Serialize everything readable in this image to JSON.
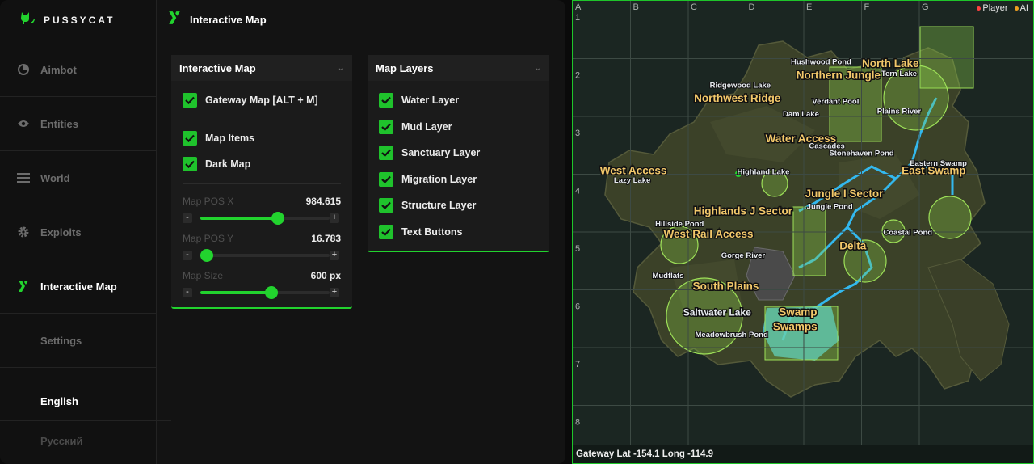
{
  "brand": {
    "name": "PUSSYCAT"
  },
  "topbar": {
    "title": "Interactive Map"
  },
  "sidebar": {
    "items": [
      {
        "label": "Aimbot",
        "icon": "aimbot-icon"
      },
      {
        "label": "Entities",
        "icon": "eye-icon"
      },
      {
        "label": "World",
        "icon": "menu-icon"
      },
      {
        "label": "Exploits",
        "icon": "gear-icon"
      },
      {
        "label": "Interactive Map",
        "icon": "map-logo-icon",
        "active": true
      },
      {
        "label": "Settings"
      }
    ],
    "languages": [
      {
        "label": "English",
        "active": true
      },
      {
        "label": "Русский"
      }
    ]
  },
  "map_panel": {
    "title": "Interactive Map",
    "gateway_label": "Gateway Map [ALT + M]",
    "map_items_label": "Map Items",
    "dark_map_label": "Dark Map",
    "pos_x": {
      "label": "Map POS X",
      "value": "984.615",
      "fraction": 0.6
    },
    "pos_y": {
      "label": "Map POS Y",
      "value": "16.783",
      "fraction": 0.05
    },
    "size": {
      "label": "Map Size",
      "value": "600 px",
      "fraction": 0.55
    }
  },
  "layers_panel": {
    "title": "Map Layers",
    "items": [
      "Water Layer",
      "Mud Layer",
      "Sanctuary Layer",
      "Migration Layer",
      "Structure Layer",
      "Text Buttons"
    ]
  },
  "map": {
    "columns": [
      "A",
      "B",
      "C",
      "D",
      "E",
      "F",
      "G"
    ],
    "rows": [
      "1",
      "2",
      "3",
      "4",
      "5",
      "6",
      "7",
      "8"
    ],
    "legend": {
      "player": "Player",
      "ai": "AI"
    },
    "status": "Gateway  Lat -154.1  Long -114.9",
    "regions": [
      {
        "text": "North Lake",
        "col": 6.5,
        "row": 2.15,
        "kind": "region"
      },
      {
        "text": "Northern Jungle",
        "col": 5.6,
        "row": 2.35,
        "kind": "region"
      },
      {
        "text": "Northwest Ridge",
        "col": 3.85,
        "row": 2.75,
        "kind": "region"
      },
      {
        "text": "Water Access",
        "col": 4.95,
        "row": 3.45,
        "kind": "region"
      },
      {
        "text": "West Access",
        "col": 2.05,
        "row": 4.0,
        "kind": "region"
      },
      {
        "text": "East Swamp",
        "col": 7.25,
        "row": 4.0,
        "kind": "region"
      },
      {
        "text": "Jungle I Sector",
        "col": 5.7,
        "row": 4.4,
        "kind": "region"
      },
      {
        "text": "Highlands J Sector",
        "col": 3.95,
        "row": 4.7,
        "kind": "region"
      },
      {
        "text": "West Rail Access",
        "col": 3.35,
        "row": 5.1,
        "kind": "region"
      },
      {
        "text": "Delta",
        "col": 5.85,
        "row": 5.3,
        "kind": "region"
      },
      {
        "text": "South Plains",
        "col": 3.65,
        "row": 6.0,
        "kind": "region"
      },
      {
        "text": "Swamp",
        "col": 4.9,
        "row": 6.45,
        "kind": "region"
      },
      {
        "text": "Swamps",
        "col": 4.85,
        "row": 6.7,
        "kind": "region"
      },
      {
        "text": "Hushwood Pond",
        "col": 5.3,
        "row": 2.1,
        "kind": "place"
      },
      {
        "text": "Tern Lake",
        "col": 6.65,
        "row": 2.3,
        "kind": "place"
      },
      {
        "text": "Ridgewood Lake",
        "col": 3.9,
        "row": 2.5,
        "kind": "place"
      },
      {
        "text": "Verdant Pool",
        "col": 5.55,
        "row": 2.78,
        "kind": "place"
      },
      {
        "text": "Plains River",
        "col": 6.65,
        "row": 2.95,
        "kind": "place"
      },
      {
        "text": "Dam Lake",
        "col": 4.95,
        "row": 3.0,
        "kind": "place"
      },
      {
        "text": "Cascades",
        "col": 5.4,
        "row": 3.55,
        "kind": "place"
      },
      {
        "text": "Stonehaven Pond",
        "col": 6.0,
        "row": 3.68,
        "kind": "place"
      },
      {
        "text": "Eastern Swamp",
        "col": 7.33,
        "row": 3.85,
        "kind": "place"
      },
      {
        "text": "Highland Lake",
        "col": 4.3,
        "row": 4.0,
        "kind": "place"
      },
      {
        "text": "Lazy Lake",
        "col": 2.03,
        "row": 4.15,
        "kind": "place"
      },
      {
        "text": "Jungle Pond",
        "col": 5.45,
        "row": 4.6,
        "kind": "place"
      },
      {
        "text": "Hillside Pond",
        "col": 2.85,
        "row": 4.9,
        "kind": "place"
      },
      {
        "text": "Coastal Pond",
        "col": 6.8,
        "row": 5.05,
        "kind": "place"
      },
      {
        "text": "Gorge River",
        "col": 3.95,
        "row": 5.45,
        "kind": "place"
      },
      {
        "text": "Mudflats",
        "col": 2.65,
        "row": 5.8,
        "kind": "place"
      },
      {
        "text": "Saltwater Lake",
        "col": 3.5,
        "row": 6.45,
        "kind": "region-sm"
      },
      {
        "text": "Meadowbrush Pond",
        "col": 3.75,
        "row": 6.82,
        "kind": "place"
      }
    ],
    "colors": {
      "accent": "#22d32e",
      "water": "#33b8ee",
      "region_text": "#f2c86a",
      "player": "#ff4040",
      "ai": "#f0a020"
    }
  }
}
